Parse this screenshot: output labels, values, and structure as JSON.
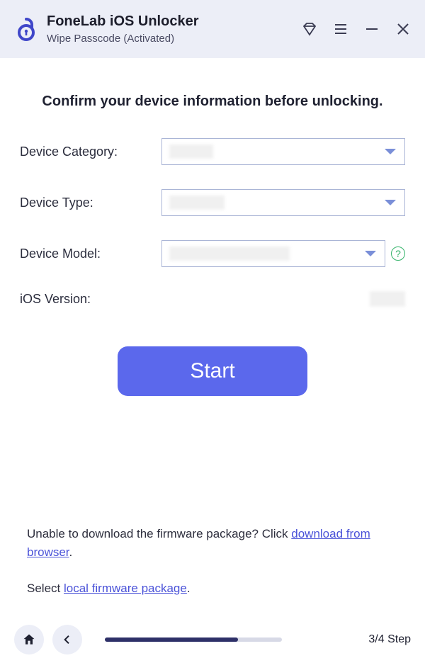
{
  "titlebar": {
    "app_title": "FoneLab iOS Unlocker",
    "subtitle": "Wipe Passcode  (Activated)"
  },
  "main": {
    "heading": "Confirm your device information before unlocking.",
    "labels": {
      "device_category": "Device Category:",
      "device_type": "Device Type:",
      "device_model": "Device Model:",
      "ios_version": "iOS Version:"
    },
    "selects": {
      "device_category": "",
      "device_type": "",
      "device_model": ""
    },
    "ios_version_value": "",
    "start_label": "Start",
    "help_glyph": "?"
  },
  "bottom": {
    "prefix1": "Unable to download the firmware package? Click ",
    "link1": "download from browser",
    "suffix1": ".",
    "prefix2": "Select ",
    "link2": "local firmware package",
    "suffix2": "."
  },
  "footer": {
    "progress_percent": 75,
    "step_label": "3/4 Step"
  }
}
